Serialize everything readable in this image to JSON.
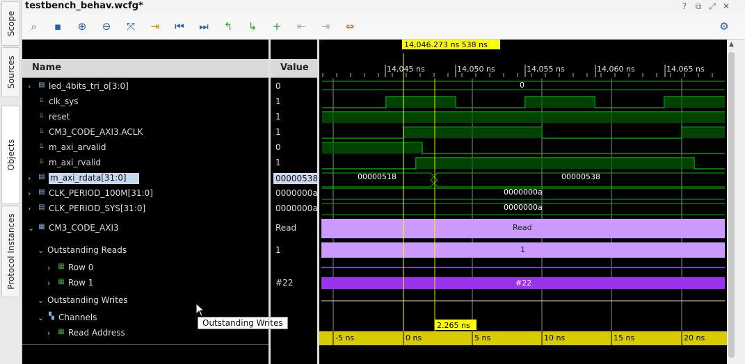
{
  "window": {
    "title": "testbench_behav.wcfg*"
  },
  "window_controls": [
    "?",
    "⧉",
    "⤢",
    "✕"
  ],
  "side_tabs": [
    "Scope",
    "Sources",
    "Objects",
    "Protocol Instances"
  ],
  "columns": {
    "name": "Name",
    "value": "Value"
  },
  "cursor": {
    "time_label": "14,046.273 ns 538 ns",
    "delta_label": "2.265 ns"
  },
  "time_ruler": [
    "14,045 ns",
    "14,050 ns",
    "14,055 ns",
    "14,060 ns",
    "14,065 ns"
  ],
  "rel_ruler": [
    "-5 ns",
    "0 ns",
    "5 ns",
    "10 ns",
    "15 ns",
    "20 ns"
  ],
  "signals": [
    {
      "name": "led_4bits_tri_o[3:0]",
      "value": "0",
      "kind": "bus",
      "expand": true,
      "indent": 0
    },
    {
      "name": "clk_sys",
      "value": "1",
      "kind": "bit",
      "expand": false,
      "indent": 0
    },
    {
      "name": "reset",
      "value": "1",
      "kind": "bit",
      "expand": false,
      "indent": 0
    },
    {
      "name": "CM3_CODE_AXI3.ACLK",
      "value": "1",
      "kind": "bit",
      "expand": false,
      "indent": 0
    },
    {
      "name": "m_axi_arvalid",
      "value": "0",
      "kind": "bit",
      "expand": false,
      "indent": 0
    },
    {
      "name": "m_axi_rvalid",
      "value": "1",
      "kind": "bit",
      "expand": false,
      "indent": 0
    },
    {
      "name": "m_axi_rdata[31:0]",
      "value": "00000538",
      "kind": "bus",
      "expand": true,
      "indent": 0,
      "selected": true
    },
    {
      "name": "CLK_PERIOD_100M[31:0]",
      "value": "0000000a",
      "kind": "bus",
      "expand": true,
      "indent": 0
    },
    {
      "name": "CLK_PERIOD_SYS[31:0]",
      "value": "0000000a",
      "kind": "bus",
      "expand": true,
      "indent": 0
    },
    {
      "name": "CM3_CODE_AXI3",
      "value": "Read",
      "kind": "proto",
      "expand": true,
      "indent": 0
    },
    {
      "name": "Outstanding Reads",
      "value": "1",
      "kind": "group",
      "expand": true,
      "indent": 1
    },
    {
      "name": "Row 0",
      "value": "",
      "kind": "row",
      "expand": true,
      "indent": 2
    },
    {
      "name": "Row 1",
      "value": "#22",
      "kind": "row",
      "expand": true,
      "indent": 2
    },
    {
      "name": "Outstanding Writes",
      "value": "",
      "kind": "group",
      "expand": true,
      "indent": 1
    },
    {
      "name": "Channels",
      "value": "",
      "kind": "chan",
      "expand": true,
      "indent": 1
    },
    {
      "name": "Read Address",
      "value": "",
      "kind": "row",
      "expand": true,
      "indent": 2
    }
  ],
  "wave_labels": {
    "led": "0",
    "rdata_a": "00000518",
    "rdata_b": "00000538",
    "clk100": "0000000a",
    "clksys": "0000000a",
    "proto": "Read",
    "out_reads": "1",
    "row1": "#22"
  },
  "tooltip": "Outstanding Writes",
  "colors": {
    "signal": "#00c000",
    "bus": "#00e000",
    "proto": "#cc99ff",
    "row1": "#9933ee",
    "marker": "#ffff00"
  }
}
